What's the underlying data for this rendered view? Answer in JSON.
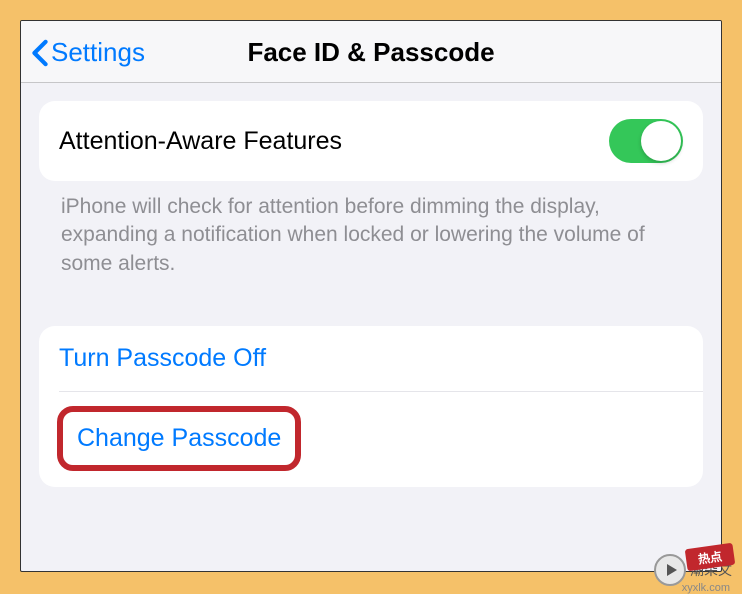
{
  "navbar": {
    "back_label": "Settings",
    "title": "Face ID & Passcode"
  },
  "attention_section": {
    "label": "Attention-Aware Features",
    "toggle_on": true,
    "footer": "iPhone will check for attention before dimming the display, expanding a notification when locked or lowering the volume of some alerts."
  },
  "passcode_section": {
    "turn_off_label": "Turn Passcode Off",
    "change_label": "Change Passcode"
  },
  "highlight": {
    "color": "#c1272d"
  },
  "watermark": {
    "text": "潮朵文",
    "stamp": "热点",
    "url": "xyxlk.com"
  }
}
